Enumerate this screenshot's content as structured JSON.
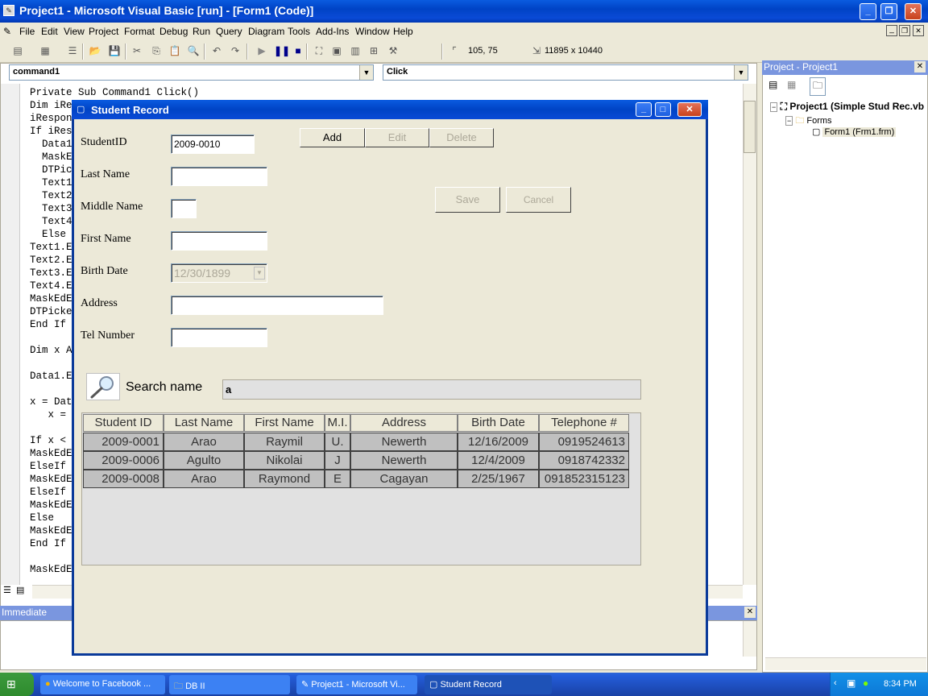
{
  "window": {
    "title": "Project1 - Microsoft Visual Basic [run] - [Form1 (Code)]"
  },
  "menu": [
    "File",
    "Edit",
    "View",
    "Project",
    "Format",
    "Debug",
    "Run",
    "Query",
    "Diagram",
    "Tools",
    "Add-Ins",
    "Window",
    "Help"
  ],
  "toolbar": {
    "position": "105, 75",
    "size": "11895 x 10440"
  },
  "code": {
    "object_combo": "command1",
    "proc_combo": "Click",
    "lines": [
      "Private Sub Command1 Click()",
      "Dim iRe",
      "iRespon",
      "If iRes",
      "  Data1",
      "  MaskE",
      "  DTPic",
      "  Text1",
      "  Text2",
      "  Text3",
      "  Text4",
      "  Else",
      "Text1.E",
      "Text2.E",
      "Text3.E",
      "Text4.E",
      "MaskEdE",
      "DTPicke",
      "End If",
      "",
      "Dim x A",
      "",
      "Data1.E",
      "",
      "x = Dat",
      "   x =",
      "",
      "If x <",
      "MaskEdE",
      "ElseIf",
      "MaskEdE",
      "ElseIf",
      "MaskEdE",
      "Else",
      "MaskEdE",
      "End If",
      "",
      "MaskEdE"
    ]
  },
  "project": {
    "title": "Project - Project1",
    "root": "Project1 (Simple Stud Rec.vb",
    "folder": "Forms",
    "file": "Form1 (Frm1.frm)"
  },
  "immediate": {
    "title": "Immediate"
  },
  "form": {
    "title": "Student Record",
    "labels": {
      "student_id": "StudentID",
      "last_name": "Last Name",
      "middle_name": "Middle Name",
      "first_name": "First Name",
      "birth_date": "Birth Date",
      "address": "Address",
      "tel": "Tel Number"
    },
    "values": {
      "student_id": "2009-0010",
      "birth_date": "12/30/1899"
    },
    "buttons": {
      "add": "Add",
      "edit": "Edit",
      "delete": "Delete",
      "save": "Save",
      "cancel": "Cancel"
    },
    "search": {
      "label": "Search name",
      "value": "a"
    },
    "grid": {
      "columns": [
        "Student ID",
        "Last Name",
        "First Name",
        "M.I.",
        "Address",
        "Birth Date",
        "Telephone #"
      ],
      "rows": [
        [
          "2009-0001",
          "Arao",
          "Raymil",
          "U.",
          "Newerth",
          "12/16/2009",
          "0919524613"
        ],
        [
          "2009-0006",
          "Agulto",
          "Nikolai",
          "J",
          "Newerth",
          "12/4/2009",
          "0918742332"
        ],
        [
          "2009-0008",
          "Arao",
          "Raymond",
          "E",
          "Cagayan",
          "2/25/1967",
          "091852315123"
        ]
      ]
    }
  },
  "taskbar": {
    "tasks": [
      "Welcome to Facebook ...",
      "DB II",
      "Project1 - Microsoft Vi...",
      "Student Record"
    ],
    "clock": "8:34 PM"
  }
}
